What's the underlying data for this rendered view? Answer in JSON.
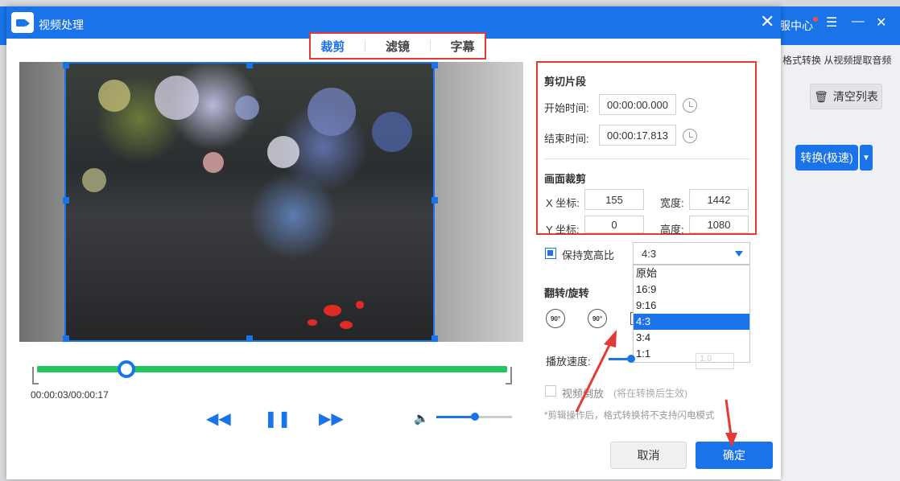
{
  "background_app": {
    "service": "服中心",
    "tabs_text": "格式转换 从视频提取音频",
    "clear_list": "清空列表",
    "convert": "转换(极速)"
  },
  "dialog": {
    "title": "视频处理",
    "tabs": [
      {
        "label": "裁剪",
        "active": true
      },
      {
        "label": "滤镜"
      },
      {
        "label": "字幕"
      }
    ],
    "player": {
      "time": "00:00:03/00:00:17",
      "progress": 0.2,
      "volume": 0.5
    },
    "clip": {
      "title": "剪切片段",
      "start_label": "开始时间:",
      "start_value": "00:00:00.000",
      "end_label": "结束时间:",
      "end_value": "00:00:17.813"
    },
    "crop": {
      "title": "画面裁剪",
      "x_label": "X 坐标:",
      "x_value": "155",
      "width_label": "宽度:",
      "width_value": "1442",
      "y_label": "Y 坐标:",
      "y_value": "0",
      "height_label": "高度:",
      "height_value": "1080"
    },
    "aspect": {
      "label": "保持宽高比",
      "checked": true,
      "selected": "4:3",
      "options": [
        "原始",
        "16:9",
        "9:16",
        "4:3",
        "3:4",
        "1:1"
      ]
    },
    "flip": {
      "title": "翻转/旋转",
      "rot_cw": "90°",
      "rot_ccw": "90°"
    },
    "speed": {
      "label": "播放速度:",
      "value": "1.0"
    },
    "reverse": {
      "label": "视频倒放",
      "note": "(将在转换后生效)"
    },
    "hint": "*剪辑操作后，格式转换将不支持闪电模式",
    "cancel": "取消",
    "ok": "确定",
    "colors": {
      "accent": "#1a73e8",
      "highlight": "#e53935",
      "timeline": "#22c55e"
    }
  }
}
